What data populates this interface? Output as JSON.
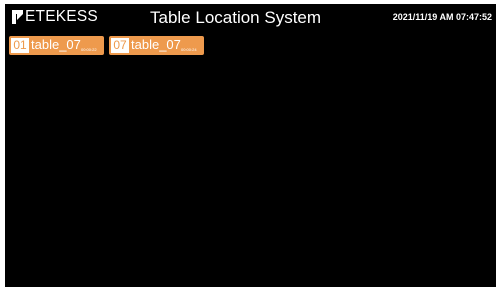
{
  "header": {
    "logo_text": "ETEKESS",
    "title": "Table Location System",
    "datetime": "2021/11/19 AM 07:47:52"
  },
  "tables": [
    {
      "number": "01",
      "name": "table_07",
      "time": "00:00:22"
    },
    {
      "number": "07",
      "name": "table_07",
      "time": "00:00:24"
    }
  ],
  "colors": {
    "background": "#000000",
    "tile": "#ee9a4d",
    "text": "#ffffff"
  }
}
